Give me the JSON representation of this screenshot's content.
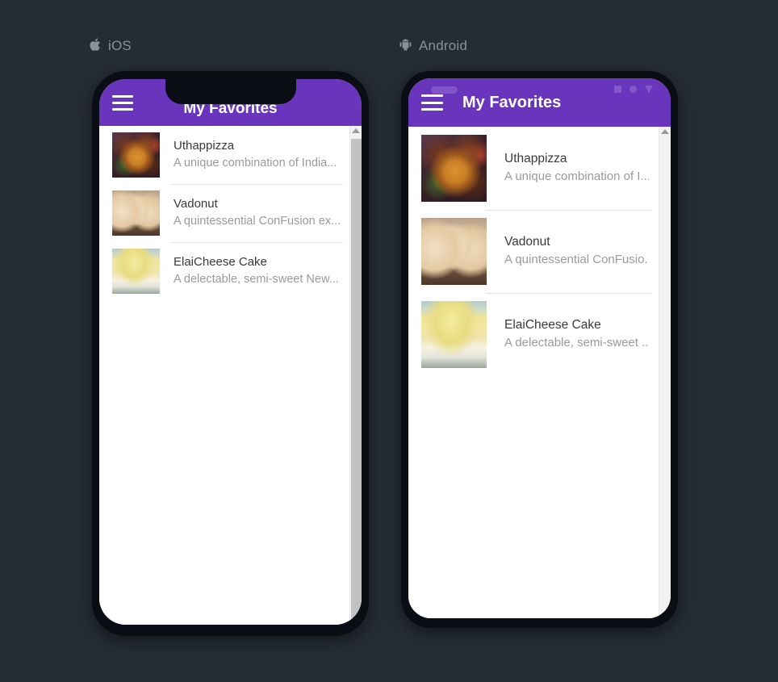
{
  "background_color": "#252c35",
  "accent_color": "#6a35bd",
  "platforms": [
    {
      "id": "ios",
      "label": "iOS",
      "icon": "apple-logo-icon",
      "icon_glyph": "",
      "appbar": {
        "title": "My Favorites",
        "menu_icon": "hamburger-menu-icon"
      },
      "items": [
        {
          "name": "Uthappizza",
          "description": "A unique combination of India...",
          "image": "uthappizza-thumbnail"
        },
        {
          "name": "Vadonut",
          "description": "A quintessential ConFusion ex...",
          "image": "vadonut-thumbnail"
        },
        {
          "name": "ElaiCheese Cake",
          "description": "A delectable, semi-sweet New...",
          "image": "elaicheese-thumbnail"
        }
      ]
    },
    {
      "id": "android",
      "label": "Android",
      "icon": "android-robot-icon",
      "icon_glyph": "▢",
      "appbar": {
        "title": "My Favorites",
        "menu_icon": "hamburger-menu-icon"
      },
      "status_icons": [
        "square-icon",
        "circle-icon",
        "triangle-icon"
      ],
      "items": [
        {
          "name": "Uthappizza",
          "description": "A unique combination of I...",
          "image": "uthappizza-thumbnail"
        },
        {
          "name": "Vadonut",
          "description": "A quintessential ConFusio...",
          "image": "vadonut-thumbnail"
        },
        {
          "name": "ElaiCheese Cake",
          "description": "A delectable, semi-sweet ...",
          "image": "elaicheese-thumbnail"
        }
      ]
    }
  ]
}
